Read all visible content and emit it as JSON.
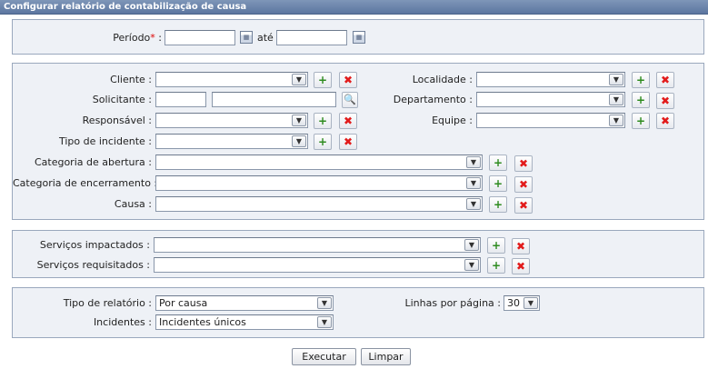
{
  "title": "Configurar relatório de contabilização de causa",
  "period": {
    "label": "Período",
    "required_mark": "*",
    "colon": ":",
    "until_label": "até",
    "start_value": "",
    "end_value": ""
  },
  "filters": {
    "cliente": {
      "label": "Cliente :",
      "value": ""
    },
    "localidade": {
      "label": "Localidade :",
      "value": ""
    },
    "solicitante": {
      "label": "Solicitante :",
      "code_value": "",
      "name_value": ""
    },
    "departamento": {
      "label": "Departamento :",
      "value": ""
    },
    "responsavel": {
      "label": "Responsável :",
      "value": ""
    },
    "equipe": {
      "label": "Equipe :",
      "value": ""
    },
    "tipo_incidente": {
      "label": "Tipo de incidente :",
      "value": ""
    },
    "categoria_abertura": {
      "label": "Categoria de abertura :",
      "value": ""
    },
    "categoria_encerramento": {
      "label": "Categoria de encerramento :",
      "value": ""
    },
    "causa": {
      "label": "Causa :",
      "value": ""
    }
  },
  "services": {
    "impactados": {
      "label": "Serviços impactados :",
      "value": ""
    },
    "requisitados": {
      "label": "Serviços requisitados :",
      "value": ""
    }
  },
  "report": {
    "tipo_relatorio": {
      "label": "Tipo de relatório :",
      "value": "Por causa"
    },
    "incidentes": {
      "label": "Incidentes :",
      "value": "Incidentes únicos"
    },
    "linhas_por_pagina": {
      "label": "Linhas por página :",
      "value": "30"
    }
  },
  "actions": {
    "execute_label": "Executar",
    "clear_label": "Limpar"
  },
  "icons": {
    "dropdown": "▼",
    "add": "+",
    "remove": "✖",
    "search": "🔍",
    "calendar": "▦"
  }
}
